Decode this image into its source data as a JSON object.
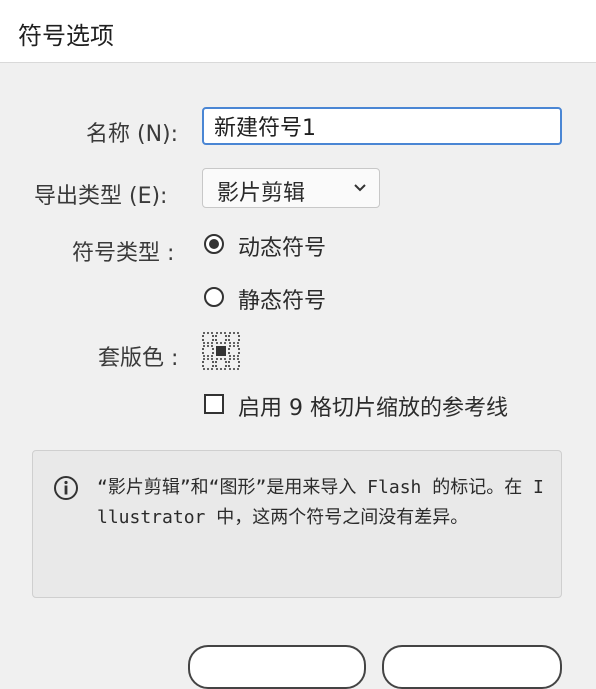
{
  "dialog": {
    "title": "符号选项"
  },
  "form": {
    "name_label": "名称 (N):",
    "name_value": "新建符号1",
    "export_label": "导出类型 (E):",
    "export_value": "影片剪辑",
    "symbol_type_label": "符号类型 :",
    "radio_dynamic": "动态符号",
    "radio_static": "静态符号",
    "selected_symbol_type": "动态符号",
    "registration_label": "套版色 :",
    "nine_slice_label": "启用 9 格切片缩放的参考线",
    "nine_slice_checked": false
  },
  "info": {
    "text": "“影片剪辑”和“图形”是用来导入 Flash 的标记。在 Illustrator 中，这两个符号之间没有差异。"
  },
  "icons": {
    "info": "info-circle-icon",
    "chevron": "chevron-down-icon",
    "registration": "registration-grid-icon"
  },
  "colors": {
    "focus_border": "#4a86d4",
    "background": "#f0f0f0"
  }
}
